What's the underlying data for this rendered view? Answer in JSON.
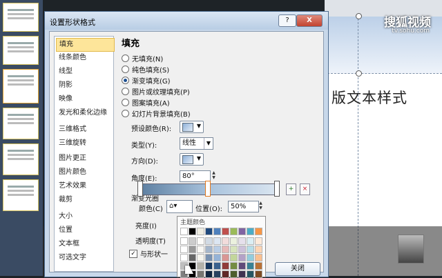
{
  "watermark": {
    "brand": "搜狐视频",
    "url": "tv.sohu.com"
  },
  "slide": {
    "text": "版文本样式"
  },
  "dialog": {
    "title": "设置形状格式",
    "help": "?",
    "close": "X",
    "nav": [
      "填充",
      "线条颜色",
      "线型",
      "阴影",
      "映像",
      "发光和柔化边缘",
      "三维格式",
      "三维旋转",
      "图片更正",
      "图片颜色",
      "艺术效果",
      "裁剪",
      "大小",
      "位置",
      "文本框",
      "可选文字"
    ],
    "nav_selected": 0,
    "fill": {
      "heading": "填充",
      "options": [
        "无填充(N)",
        "纯色填充(S)",
        "渐变填充(G)",
        "图片或纹理填充(P)",
        "图案填充(A)",
        "幻灯片背景填充(B)"
      ],
      "selected_option": 2,
      "preset_label": "预设颜色(R):",
      "type_label": "类型(Y):",
      "type_value": "线性",
      "direction_label": "方向(D):",
      "angle_label": "角度(E):",
      "angle_value": "80°",
      "stops_label": "渐变光圈",
      "color_label": "颜色(C)",
      "position_label": "位置(O):",
      "position_value": "50%",
      "brightness_label": "亮度(I)",
      "transparency_label": "透明度(T)",
      "rotate_label": "与形状一"
    },
    "palette": {
      "title": "主题颜色",
      "columns": [
        "#ffffff",
        "#000000",
        "#eeece1",
        "#1f497d",
        "#4f81bd",
        "#c0504d",
        "#9bbb59",
        "#8064a2",
        "#4bacc6",
        "#f79646"
      ]
    },
    "close_button": "关闭"
  }
}
